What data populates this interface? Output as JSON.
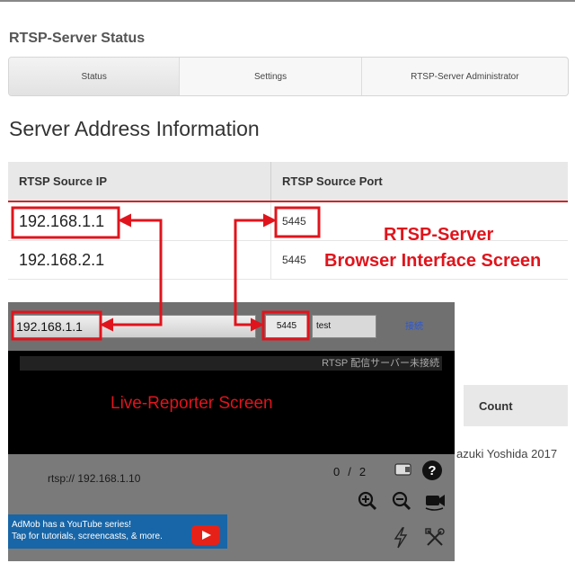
{
  "app": {
    "title": "RTSP-Server Status"
  },
  "tabs": [
    {
      "label": "Status",
      "active": true
    },
    {
      "label": "Settings",
      "active": false
    },
    {
      "label": "RTSP-Server Administrator",
      "active": false
    }
  ],
  "section": {
    "title": "Server Address Information"
  },
  "table": {
    "headers": [
      "RTSP Source IP",
      "RTSP Source Port"
    ],
    "rows": [
      [
        "192.168.1.1",
        "5445"
      ],
      [
        "192.168.2.1",
        "5445"
      ]
    ]
  },
  "annotations": {
    "browser_line1": "RTSP-Server",
    "browser_line2": "Browser Interface Screen",
    "live_reporter": "Live-Reporter Screen"
  },
  "second_table": {
    "count_header": "Count"
  },
  "footer": {
    "credit": "azuki Yoshida 2017"
  },
  "live_reporter": {
    "ip_value": "192.168.1.1",
    "port_value": "5445",
    "user_value": "test",
    "connect_label": "接続",
    "status_text": "RTSP 配信サーバー未接続",
    "url_text": "rtsp:// 192.168.1.10",
    "counter_current": "0",
    "counter_sep": "/",
    "counter_total": "2",
    "admob_line1": "AdMob has a YouTube series!",
    "admob_line2": "Tap for tutorials, screencasts, & more.",
    "icons": [
      "card-icon",
      "help-icon",
      "zoom-in-icon",
      "zoom-out-icon",
      "camera-switch-icon",
      "flash-icon",
      "settings-tools-icon",
      "youtube-play-icon"
    ]
  },
  "colors": {
    "annotation_red": "#e0141c",
    "table_accent": "#c9282d",
    "link_blue": "#2a58d8",
    "admob_blue": "#1866a7"
  }
}
